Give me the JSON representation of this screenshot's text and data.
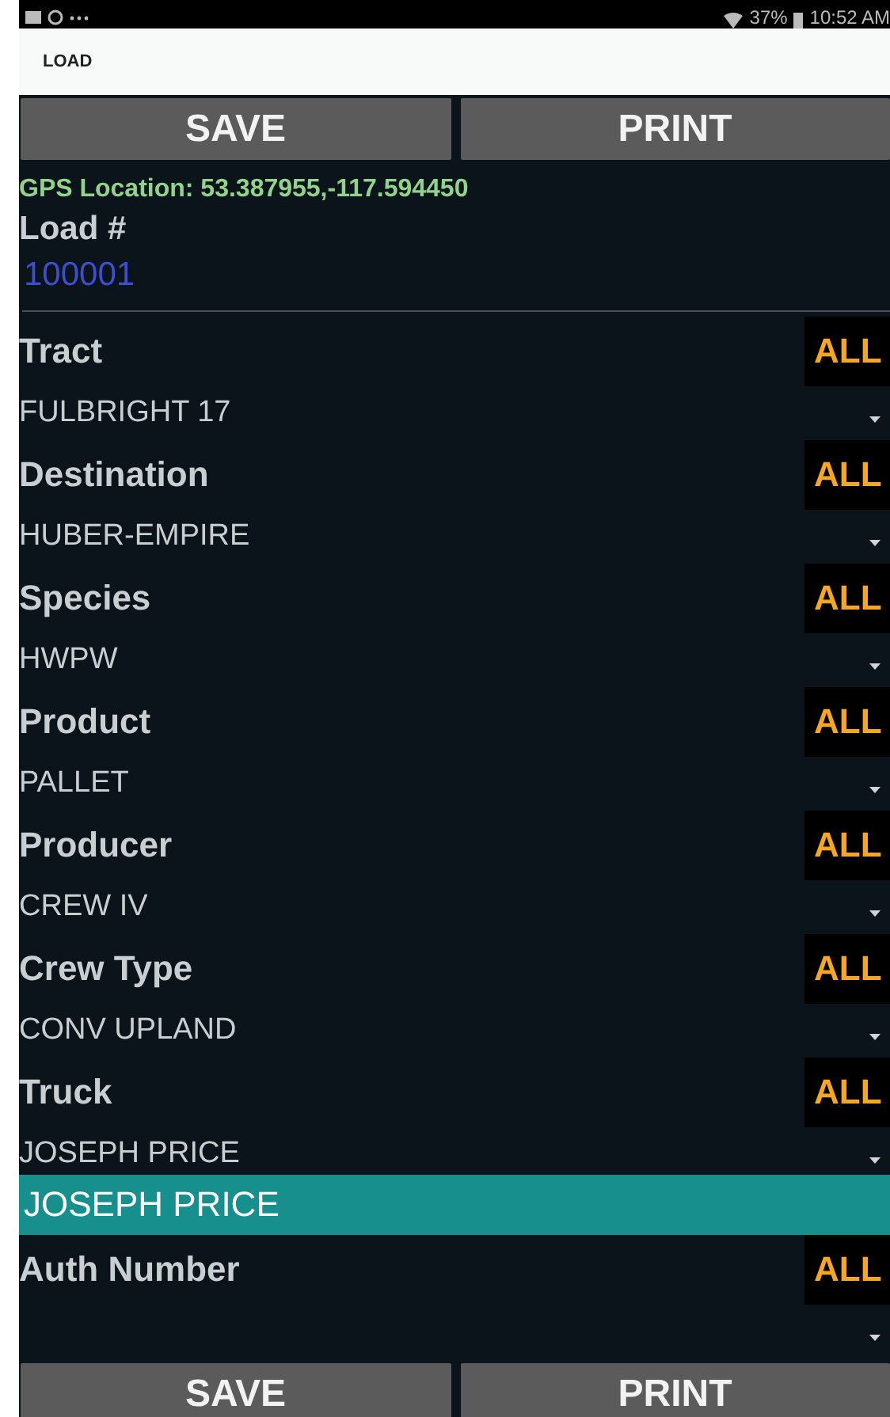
{
  "status_bar": {
    "battery": "37%",
    "time": "10:52 AM"
  },
  "app_bar": {
    "title": "LOAD"
  },
  "top_buttons": [
    "SAVE",
    "PRINT"
  ],
  "gps": "GPS Location: 53.387955,-117.594450",
  "load_number": {
    "label": "Load #",
    "value": "100001"
  },
  "fields": [
    {
      "label": "Tract",
      "filter": "ALL",
      "value": "FULBRIGHT 17"
    },
    {
      "label": "Destination",
      "filter": "ALL",
      "value": "HUBER-EMPIRE"
    },
    {
      "label": "Species",
      "filter": "ALL",
      "value": "HWPW"
    },
    {
      "label": "Product",
      "filter": "ALL",
      "value": "PALLET"
    },
    {
      "label": "Producer",
      "filter": "ALL",
      "value": "CREW IV"
    },
    {
      "label": "Crew Type",
      "filter": "ALL",
      "value": "CONV UPLAND"
    },
    {
      "label": "Truck",
      "filter": "ALL",
      "value": "JOSEPH PRICE",
      "suggestions": [
        {
          "text": "JOSEPH PRICE",
          "selected": true
        }
      ]
    },
    {
      "label": "Auth Number",
      "filter": "ALL"
    }
  ],
  "bottom_buttons": [
    "SAVE",
    "PRINT"
  ]
}
